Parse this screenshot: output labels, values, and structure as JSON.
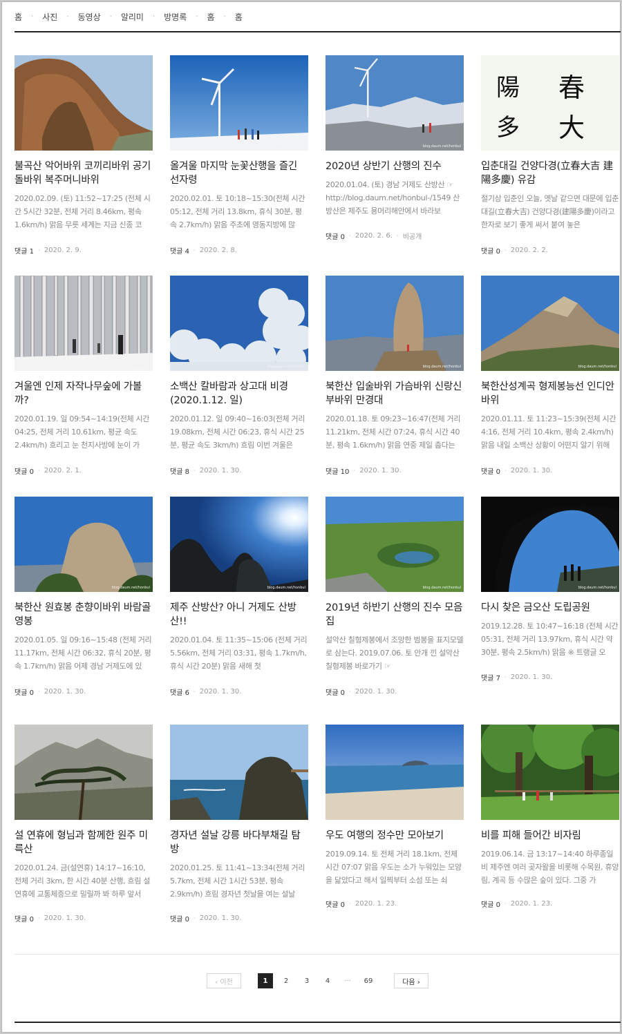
{
  "nav": {
    "items": [
      "홈",
      "사진",
      "동영상",
      "알리미",
      "방명록",
      "홈",
      "홈"
    ]
  },
  "posts": [
    {
      "title": "불곡산 악어바위 코끼리바위 공기돌바위 복주머니바위",
      "excerpt": "2020.02.09. (토) 11:52~17:25 (전체 시간 5시간 32분, 전체 거리 8.46km, 평속 1.6km/h) 맑음 무릇 세계는 지금 신종 코",
      "comments": "댓글 1",
      "date": "2020. 2. 9.",
      "extra": ""
    },
    {
      "title": "올겨울 마지막 눈꽃산행을 즐긴 선자령",
      "excerpt": "2020.02.01. 토 10:18~15:30(전체 시간 05:12, 전체 거리 13.8km, 휴식 30분, 평속 2.7km/h) 맑음 주초에 영동지방에 많",
      "comments": "댓글 4",
      "date": "2020. 2. 8.",
      "extra": ""
    },
    {
      "title": "2020년 상반기 산행의 진수",
      "excerpt": "2020.01.04. (토) 경남 거제도 산방산 ☞ http://blog.daum.net/honbul-/1549 산방산은 제주도 용머리해안에서 바라보",
      "comments": "댓글 0",
      "date": "2020. 2. 6.",
      "extra": "비공개"
    },
    {
      "title": "입춘대길 건양다경(立春大吉 建陽多慶) 유감",
      "excerpt": "절기상 입춘인 오늘, 옛날 같으면 대문에 입춘대길(立春大吉) 건양다경(建陽多慶)이라고 한자로 보기 좋게 써서 붙여 놓은",
      "comments": "댓글 0",
      "date": "2020. 2. 2.",
      "extra": ""
    },
    {
      "title": "겨울엔 인제 자작나무숲에 가볼까?",
      "excerpt": "2020.01.19. 일 09:54~14:19(전체 시간 04:25, 전체 거리 10.61km, 평균 속도 2.4km/h) 흐리고 눈 천지사방에 눈이 가",
      "comments": "댓글 0",
      "date": "2020. 2. 1.",
      "extra": ""
    },
    {
      "title": "소백산 칼바람과 상고대 비경(2020.1.12. 일)",
      "excerpt": "2020.01.12. 일 09:40~16:03(전체 거리 19.08km, 전체 시간 06:23, 휴식 시간 25분, 평균 속도 3km/h) 흐림 이번 겨울은",
      "comments": "댓글 8",
      "date": "2020. 1. 30.",
      "extra": ""
    },
    {
      "title": "북한산 입술바위 가슴바위 신랑신부바위 만경대",
      "excerpt": "2020.01.18. 토 09:23~16:47(전체 거리 11.21km, 전체 시간 07:24, 휴식 시간 40분, 평속 1.6km/h) 맑음 연중 제일 춥다는",
      "comments": "댓글 10",
      "date": "2020. 1. 30.",
      "extra": ""
    },
    {
      "title": "북한산성계곡 형제봉능선 인디안바위",
      "excerpt": "2020.01.11. 토 11:23~15:39(전체 시간 4:16, 전체 거리 10.4km, 평속 2.4km/h) 맑음 내일 소백산 상황이 어떤지 알기 위해",
      "comments": "댓글 0",
      "date": "2020. 1. 30.",
      "extra": ""
    },
    {
      "title": "북한산 원효봉 춘향이바위 바람골 영봉",
      "excerpt": "2020.01.05. 일 09:16~15:48 (전체 거리 11.17km, 전체 시간 06:32, 휴식 20분, 평속 1.7km/h) 맑음 어제 경남 거제도에 있",
      "comments": "댓글 0",
      "date": "2020. 1. 30.",
      "extra": ""
    },
    {
      "title": "제주 산방산? 아니 거제도 산방산!!",
      "excerpt": "2020.01.04. 토 11:35~15:06 (전체 거리 5.56km, 전체 거리 03:31, 평속 1.7km/h, 휴식 시간 20분) 맑음 새해 첫",
      "comments": "댓글 6",
      "date": "2020. 1. 30.",
      "extra": ""
    },
    {
      "title": "2019년 하반기 산행의 진수 모음집",
      "excerpt": "설악산 칠형제봉에서 조망한 범봉을 표지모델로 삼는다. 2019.07.06. 토 안개 낀 설악산 칠형제봉 바로가기 ☞",
      "comments": "댓글 0",
      "date": "2020. 1. 30.",
      "extra": ""
    },
    {
      "title": "다시 찾은 금오산 도립공원",
      "excerpt": "2019.12.28. 토 10:47~16:18 (전체 시간 05:31, 전체 거리 13.97km, 휴식 시간 약 30분, 평속 2.5km/h) 맑음 ※ 트랭글 오",
      "comments": "댓글 7",
      "date": "2020. 1. 30.",
      "extra": ""
    },
    {
      "title": "설 연휴에 형님과 함께한 원주 미륵산",
      "excerpt": "2020.01.24. 금(설연휴) 14:17~16:10, 전체 거리 3km, 한 시간 40분 산행, 흐림 설 연휴에 교통체증으로 밀릴까 봐 하루 앞서",
      "comments": "댓글 0",
      "date": "2020. 1. 30.",
      "extra": ""
    },
    {
      "title": "경자년 설날 강릉 바다부채길 탐방",
      "excerpt": "2020.01.25. 토 11:41~13:34(전체 거리 5.7km, 전체 시간 1시간 53분, 평속 2.9km/h) 흐림 경자년 첫날을 여는 설날",
      "comments": "댓글 0",
      "date": "2020. 1. 30.",
      "extra": ""
    },
    {
      "title": "우도 여행의 정수만 모아보기",
      "excerpt": "2019.09.14. 토 전체 거리 18.1km, 전체 시간 07:07 맑음 우도는 소가 누워있는 모양을 닮았다고 해서 일찍부터 소섬 또는 쇠",
      "comments": "댓글 0",
      "date": "2020. 1. 23.",
      "extra": ""
    },
    {
      "title": "비를 피해 들어간 비자림",
      "excerpt": "2019.06.14. 금 13:17~14:40 하루종일 비 제주엔 여러 곶자왈을 비롯해 수목원, 휴양림, 계곡 등 수많은 숲이 있다. 그중 가",
      "comments": "댓글 0",
      "date": "2020. 1. 23.",
      "extra": ""
    }
  ],
  "watermark": "blog.daum.net/honbul",
  "calligraphy": {
    "col1": "陽 多",
    "col2": "春 大"
  },
  "pager": {
    "prev": "‹ 이전",
    "next": "다음 ›",
    "pages": [
      "1",
      "2",
      "3",
      "4",
      "···",
      "69"
    ],
    "current": "1"
  }
}
